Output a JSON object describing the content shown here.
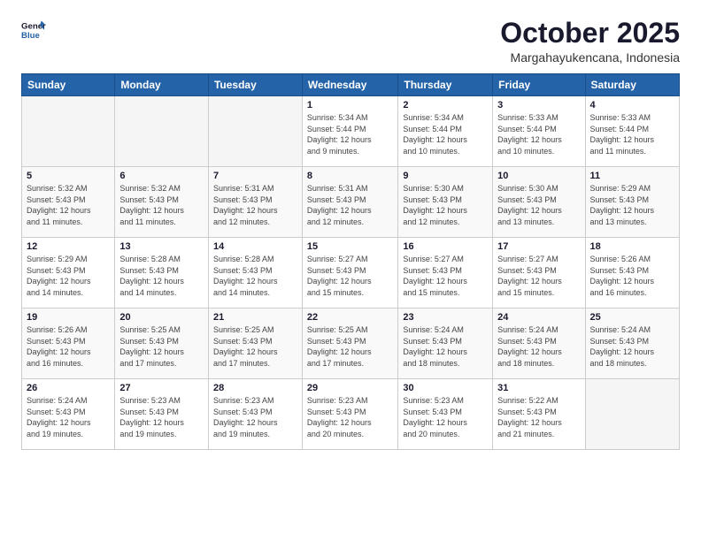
{
  "header": {
    "logo_line1": "General",
    "logo_line2": "Blue",
    "month": "October 2025",
    "location": "Margahayukencana, Indonesia"
  },
  "weekdays": [
    "Sunday",
    "Monday",
    "Tuesday",
    "Wednesday",
    "Thursday",
    "Friday",
    "Saturday"
  ],
  "weeks": [
    [
      {
        "day": "",
        "info": ""
      },
      {
        "day": "",
        "info": ""
      },
      {
        "day": "",
        "info": ""
      },
      {
        "day": "1",
        "info": "Sunrise: 5:34 AM\nSunset: 5:44 PM\nDaylight: 12 hours\nand 9 minutes."
      },
      {
        "day": "2",
        "info": "Sunrise: 5:34 AM\nSunset: 5:44 PM\nDaylight: 12 hours\nand 10 minutes."
      },
      {
        "day": "3",
        "info": "Sunrise: 5:33 AM\nSunset: 5:44 PM\nDaylight: 12 hours\nand 10 minutes."
      },
      {
        "day": "4",
        "info": "Sunrise: 5:33 AM\nSunset: 5:44 PM\nDaylight: 12 hours\nand 11 minutes."
      }
    ],
    [
      {
        "day": "5",
        "info": "Sunrise: 5:32 AM\nSunset: 5:43 PM\nDaylight: 12 hours\nand 11 minutes."
      },
      {
        "day": "6",
        "info": "Sunrise: 5:32 AM\nSunset: 5:43 PM\nDaylight: 12 hours\nand 11 minutes."
      },
      {
        "day": "7",
        "info": "Sunrise: 5:31 AM\nSunset: 5:43 PM\nDaylight: 12 hours\nand 12 minutes."
      },
      {
        "day": "8",
        "info": "Sunrise: 5:31 AM\nSunset: 5:43 PM\nDaylight: 12 hours\nand 12 minutes."
      },
      {
        "day": "9",
        "info": "Sunrise: 5:30 AM\nSunset: 5:43 PM\nDaylight: 12 hours\nand 12 minutes."
      },
      {
        "day": "10",
        "info": "Sunrise: 5:30 AM\nSunset: 5:43 PM\nDaylight: 12 hours\nand 13 minutes."
      },
      {
        "day": "11",
        "info": "Sunrise: 5:29 AM\nSunset: 5:43 PM\nDaylight: 12 hours\nand 13 minutes."
      }
    ],
    [
      {
        "day": "12",
        "info": "Sunrise: 5:29 AM\nSunset: 5:43 PM\nDaylight: 12 hours\nand 14 minutes."
      },
      {
        "day": "13",
        "info": "Sunrise: 5:28 AM\nSunset: 5:43 PM\nDaylight: 12 hours\nand 14 minutes."
      },
      {
        "day": "14",
        "info": "Sunrise: 5:28 AM\nSunset: 5:43 PM\nDaylight: 12 hours\nand 14 minutes."
      },
      {
        "day": "15",
        "info": "Sunrise: 5:27 AM\nSunset: 5:43 PM\nDaylight: 12 hours\nand 15 minutes."
      },
      {
        "day": "16",
        "info": "Sunrise: 5:27 AM\nSunset: 5:43 PM\nDaylight: 12 hours\nand 15 minutes."
      },
      {
        "day": "17",
        "info": "Sunrise: 5:27 AM\nSunset: 5:43 PM\nDaylight: 12 hours\nand 15 minutes."
      },
      {
        "day": "18",
        "info": "Sunrise: 5:26 AM\nSunset: 5:43 PM\nDaylight: 12 hours\nand 16 minutes."
      }
    ],
    [
      {
        "day": "19",
        "info": "Sunrise: 5:26 AM\nSunset: 5:43 PM\nDaylight: 12 hours\nand 16 minutes."
      },
      {
        "day": "20",
        "info": "Sunrise: 5:25 AM\nSunset: 5:43 PM\nDaylight: 12 hours\nand 17 minutes."
      },
      {
        "day": "21",
        "info": "Sunrise: 5:25 AM\nSunset: 5:43 PM\nDaylight: 12 hours\nand 17 minutes."
      },
      {
        "day": "22",
        "info": "Sunrise: 5:25 AM\nSunset: 5:43 PM\nDaylight: 12 hours\nand 17 minutes."
      },
      {
        "day": "23",
        "info": "Sunrise: 5:24 AM\nSunset: 5:43 PM\nDaylight: 12 hours\nand 18 minutes."
      },
      {
        "day": "24",
        "info": "Sunrise: 5:24 AM\nSunset: 5:43 PM\nDaylight: 12 hours\nand 18 minutes."
      },
      {
        "day": "25",
        "info": "Sunrise: 5:24 AM\nSunset: 5:43 PM\nDaylight: 12 hours\nand 18 minutes."
      }
    ],
    [
      {
        "day": "26",
        "info": "Sunrise: 5:24 AM\nSunset: 5:43 PM\nDaylight: 12 hours\nand 19 minutes."
      },
      {
        "day": "27",
        "info": "Sunrise: 5:23 AM\nSunset: 5:43 PM\nDaylight: 12 hours\nand 19 minutes."
      },
      {
        "day": "28",
        "info": "Sunrise: 5:23 AM\nSunset: 5:43 PM\nDaylight: 12 hours\nand 19 minutes."
      },
      {
        "day": "29",
        "info": "Sunrise: 5:23 AM\nSunset: 5:43 PM\nDaylight: 12 hours\nand 20 minutes."
      },
      {
        "day": "30",
        "info": "Sunrise: 5:23 AM\nSunset: 5:43 PM\nDaylight: 12 hours\nand 20 minutes."
      },
      {
        "day": "31",
        "info": "Sunrise: 5:22 AM\nSunset: 5:43 PM\nDaylight: 12 hours\nand 21 minutes."
      },
      {
        "day": "",
        "info": ""
      }
    ]
  ]
}
